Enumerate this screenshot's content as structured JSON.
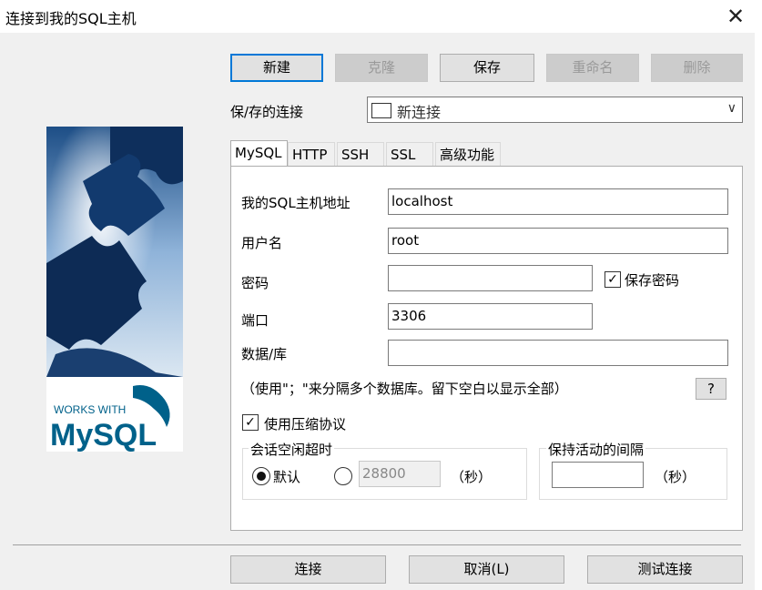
{
  "window": {
    "title": "连接到我的SQL主机"
  },
  "toolbar": {
    "new": "新建",
    "clone": "克隆",
    "save": "保存",
    "rename": "重命名",
    "delete": "删除"
  },
  "saved_connections": {
    "label": "保/存的连接",
    "value": "新连接"
  },
  "tabs": [
    "MySQL",
    "HTTP",
    "SSH",
    "SSL",
    "高级功能"
  ],
  "form": {
    "host_label": "我的SQL主机地址",
    "host_value": "localhost",
    "user_label": "用户名",
    "user_value": "root",
    "password_label": "密码",
    "password_value": "",
    "save_password_label": "保存密码",
    "port_label": "端口",
    "port_value": "3306",
    "database_label": "数据/库",
    "database_value": "",
    "hint": "（使用\"；\"来分隔多个数据库。留下空白以显示全部）",
    "help_button": "?",
    "compression_label": "使用压缩协议",
    "idle_group_title": "会话空闲超时",
    "idle_default_label": "默认",
    "idle_custom_value": "28800",
    "idle_unit": "（秒）",
    "keepalive_group_title": "保持活动的间隔",
    "keepalive_value": "",
    "keepalive_unit": "（秒）"
  },
  "logo": {
    "tagline": "WORKS WITH",
    "brand": "MySQL"
  },
  "footer": {
    "connect": "连接",
    "cancel": "取消(L)",
    "test": "测试连接"
  },
  "colors": {
    "accent": "#0078d7",
    "mysql_blue": "#00618a",
    "mysql_orange": "#e48e00"
  },
  "icons": {
    "close": "close-icon",
    "dropdown": "chevron-down-icon"
  }
}
